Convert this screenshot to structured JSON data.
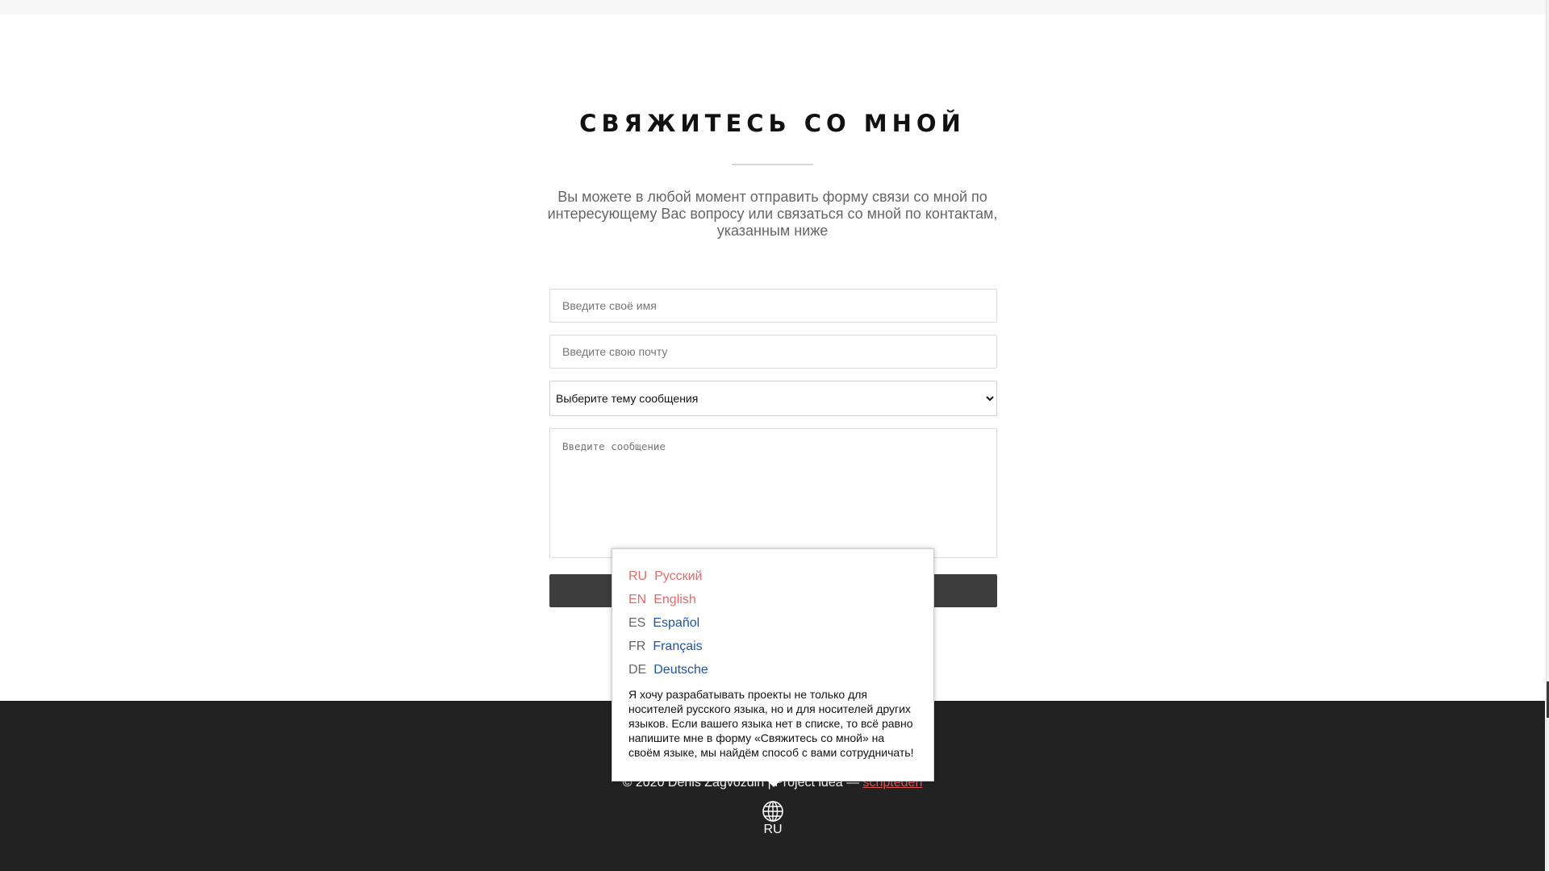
{
  "contact": {
    "title": "СВЯЖИТЕСЬ СО МНОЙ",
    "lead": "Вы можете в любой момент отправить форму связи со мной по интересующему Вас вопросу или связаться со мной по контактам, указанным ниже",
    "name_placeholder": "Введите своё имя",
    "email_placeholder": "Введите свою почту",
    "topic_selected": "Выберите тему сообщения",
    "message_placeholder": "Введите сообщение",
    "submit_label": ""
  },
  "language_popup": {
    "items": [
      {
        "code": "RU",
        "name": "Русский",
        "state": "disabled"
      },
      {
        "code": "EN",
        "name": "English",
        "state": "disabled"
      },
      {
        "code": "ES",
        "name": "Español",
        "state": "link"
      },
      {
        "code": "FR",
        "name": "Français",
        "state": "link"
      },
      {
        "code": "DE",
        "name": "Deutsche",
        "state": "link"
      }
    ],
    "note": "Я хочу разрабатывать проекты не только для носителей русского языка, но и для носителей других языков. Если вашего языка нет в списке, то всё равно напишите мне в форму «Свяжитесь со мной» на своём языке, мы найдём способ с вами сотрудничать!"
  },
  "footer": {
    "copyright_prefix": "© 2020 Denis Zagvozdin | Project idea — ",
    "author_link": "scripteden",
    "current_language": "RU",
    "globe_icon": "globe-icon"
  },
  "colors": {
    "footer_bg": "#222222",
    "link_red": "#e05757",
    "link_blue": "#1e55a6",
    "button_bg": "#3d3d3d"
  }
}
